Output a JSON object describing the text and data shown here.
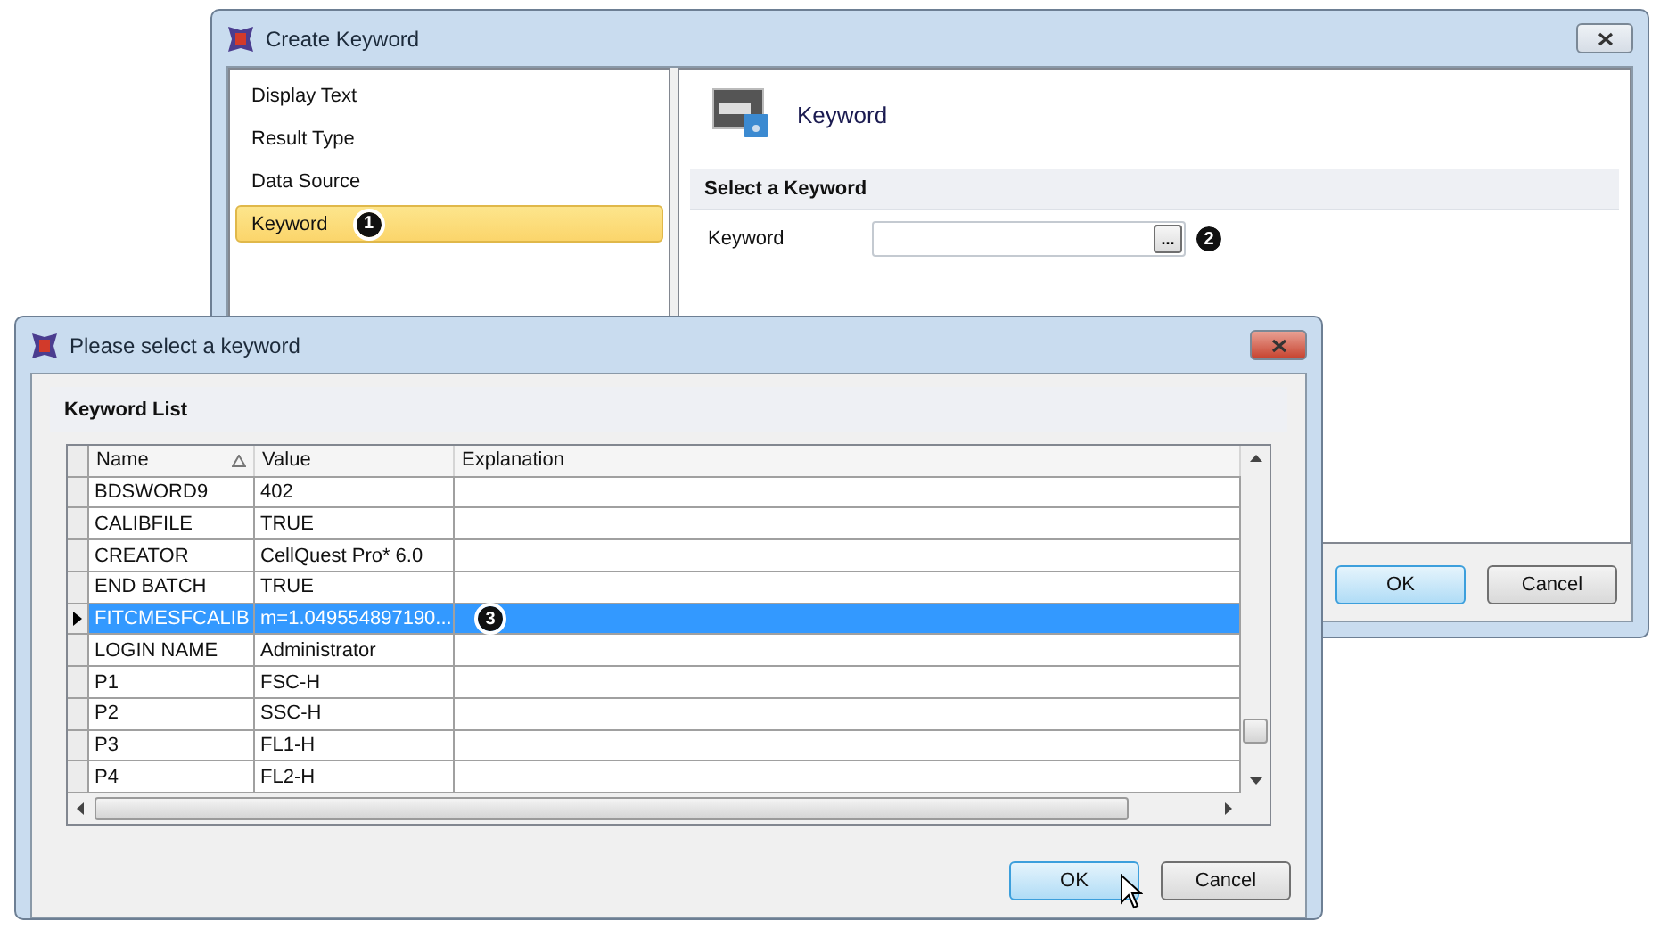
{
  "create_window": {
    "title": "Create Keyword",
    "nav_items": [
      {
        "label": "Display Text",
        "selected": false
      },
      {
        "label": "Result Type",
        "selected": false
      },
      {
        "label": "Data Source",
        "selected": false
      },
      {
        "label": "Keyword",
        "selected": true,
        "callout": "1"
      }
    ],
    "header_title": "Keyword",
    "section": "Select a Keyword",
    "field_label": "Keyword",
    "browse_label": "...",
    "field_callout": "2",
    "buttons": [
      {
        "label": "OK",
        "default": true
      },
      {
        "label": "Cancel",
        "default": false
      }
    ]
  },
  "select_window": {
    "title": "Please select a keyword",
    "section": "Keyword List",
    "columns": [
      {
        "label": "Name",
        "sorted": true
      },
      {
        "label": "Value",
        "sorted": false
      },
      {
        "label": "Explanation",
        "sorted": false
      }
    ],
    "rows": [
      {
        "name": "BDSWORD9",
        "value": "402",
        "selected": false
      },
      {
        "name": "CALIBFILE",
        "value": "TRUE",
        "selected": false
      },
      {
        "name": "CREATOR",
        "value": "CellQuest Pro* 6.0",
        "selected": false
      },
      {
        "name": "END BATCH",
        "value": "TRUE",
        "selected": false
      },
      {
        "name": "FITCMESFCALIB",
        "value": "m=1.049554897190...",
        "selected": true,
        "callout": "3"
      },
      {
        "name": "LOGIN NAME",
        "value": "Administrator",
        "selected": false
      },
      {
        "name": "P1",
        "value": "FSC-H",
        "selected": false
      },
      {
        "name": "P2",
        "value": "SSC-H",
        "selected": false
      },
      {
        "name": "P3",
        "value": "FL1-H",
        "selected": false
      },
      {
        "name": "P4",
        "value": "FL2-H",
        "selected": false
      }
    ],
    "buttons": [
      {
        "label": "OK",
        "default": true
      },
      {
        "label": "Cancel",
        "default": false
      }
    ]
  }
}
